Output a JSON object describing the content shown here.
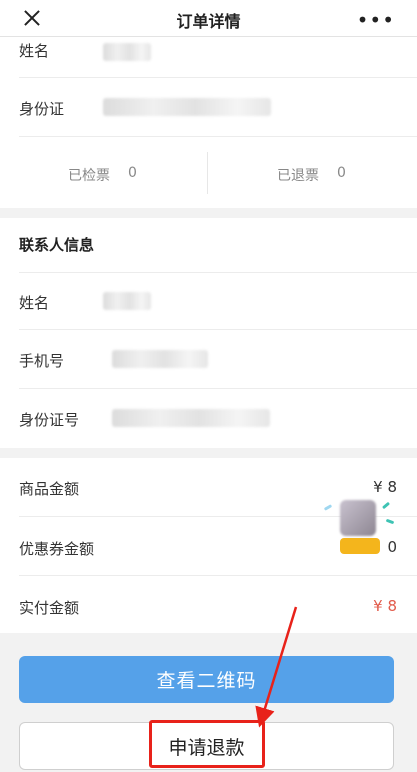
{
  "header": {
    "title": "订单详情",
    "more_label": "•••"
  },
  "passenger": {
    "name_label": "姓名",
    "id_label": "身份证",
    "checked_label": "已检票",
    "checked_count": "0",
    "refunded_label": "已退票",
    "refunded_count": "0"
  },
  "contact": {
    "title": "联系人信息",
    "name_label": "姓名",
    "phone_label": "手机号",
    "id_label": "身份证号"
  },
  "amounts": {
    "goods_label": "商品金额",
    "goods_value": "¥ 8",
    "coupon_label": "优惠券金额",
    "coupon_value": "0",
    "paid_label": "实付金额",
    "paid_value": "¥ 8"
  },
  "actions": {
    "qrcode_label": "查看二维码",
    "refund_label": "申请退款"
  },
  "colors": {
    "primary_button": "#55a1e9",
    "paid_amount": "#e25b4b",
    "highlight": "#e8221a"
  }
}
